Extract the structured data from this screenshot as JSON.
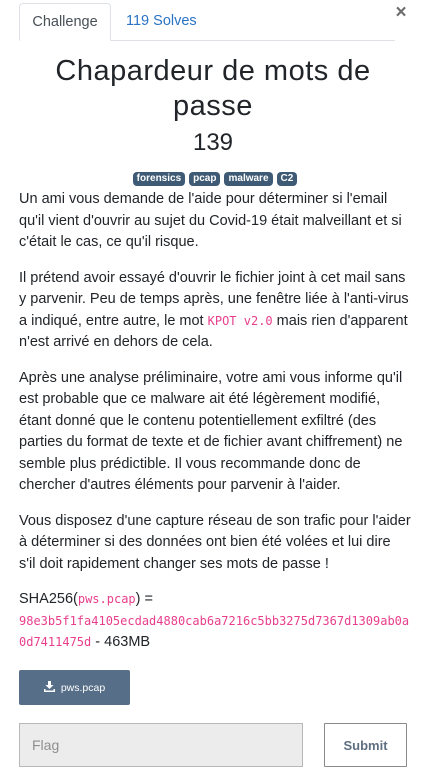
{
  "modal": {
    "close_label": "×",
    "tabs": [
      {
        "label": "Challenge",
        "active": true
      },
      {
        "label": "119 Solves",
        "active": false
      }
    ]
  },
  "challenge": {
    "title": "Chapardeur de mots de passe",
    "value": "139",
    "tags": [
      "forensics",
      "pcap",
      "malware",
      "C2"
    ],
    "description": {
      "p1": "Un ami vous demande de l'aide pour déterminer si l'email qu'il vient d'ouvrir au sujet du Covid-19 était malveillant et si c'était le cas, ce qu'il risque.",
      "p2_before": "Il prétend avoir essayé d'ouvrir le fichier joint à cet mail sans y parvenir. Peu de temps après, une fenêtre liée à l'anti-virus a indiqué, entre autre, le mot ",
      "p2_code": "KPOT v2.0",
      "p2_after": " mais rien d'apparent n'est arrivé en dehors de cela.",
      "p3": "Après une analyse préliminaire, votre ami vous informe qu'il est probable que ce malware ait été légèrement modifié, étant donné que le contenu potentiellement exfiltré (des parties du format de texte et de fichier avant chiffrement) ne semble plus prédictible. Il vous recommande donc de chercher d'autres éléments pour parvenir à l'aider.",
      "p4": "Vous disposez d'une capture réseau de son trafic pour l'aider à déterminer si des données ont bien été volées et lui dire s'il doit rapidement changer ses mots de passe !",
      "sha_prefix": "SHA256(",
      "sha_file": "pws.pcap",
      "sha_mid": ") = ",
      "sha_hash": "98e3b5f1fa4105ecdad4880cab6a7216c5bb3275d7367d1309ab0a0d7411475d",
      "sha_suffix": " - 463MB"
    },
    "file": {
      "label": "pws.pcap",
      "icon": "download-icon"
    }
  },
  "flag_form": {
    "placeholder": "Flag",
    "value": "",
    "submit_label": "Submit"
  }
}
